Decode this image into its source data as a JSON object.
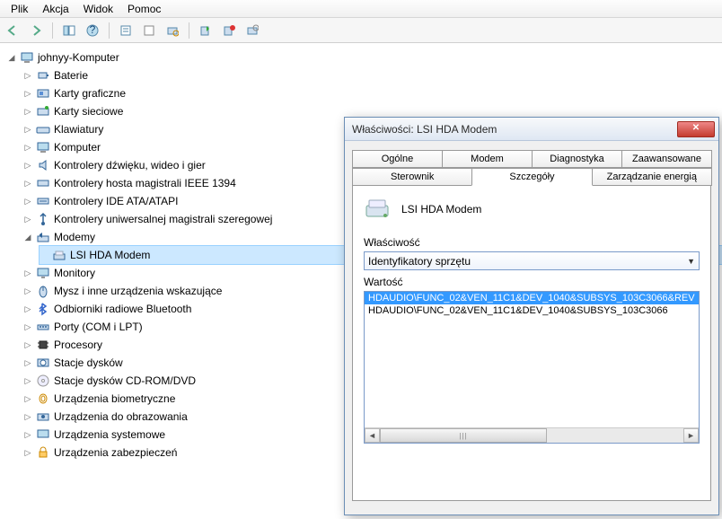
{
  "menu": {
    "file": "Plik",
    "action": "Akcja",
    "view": "Widok",
    "help": "Pomoc"
  },
  "tree": {
    "root": "johnyy-Komputer",
    "items": [
      "Baterie",
      "Karty graficzne",
      "Karty sieciowe",
      "Klawiatury",
      "Komputer",
      "Kontrolery dźwięku, wideo i gier",
      "Kontrolery hosta magistrali IEEE 1394",
      "Kontrolery IDE ATA/ATAPI",
      "Kontrolery uniwersalnej magistrali szeregowej",
      "Modemy"
    ],
    "modem_child": "LSI HDA Modem",
    "items2": [
      "Monitory",
      "Mysz i inne urządzenia wskazujące",
      "Odbiorniki radiowe Bluetooth",
      "Porty (COM i LPT)",
      "Procesory",
      "Stacje dysków",
      "Stacje dysków CD-ROM/DVD",
      "Urządzenia biometryczne",
      "Urządzenia do obrazowania",
      "Urządzenia systemowe",
      "Urządzenia zabezpieczeń"
    ]
  },
  "dialog": {
    "title": "Właściwości: LSI HDA Modem",
    "tabs_row1": [
      "Ogólne",
      "Modem",
      "Diagnostyka",
      "Zaawansowane"
    ],
    "tabs_row2": [
      "Sterownik",
      "Szczegóły",
      "Zarządzanie energią"
    ],
    "device_name": "LSI HDA Modem",
    "property_label": "Właściwość",
    "property_value": "Identyfikatory sprzętu",
    "value_label": "Wartość",
    "values": [
      "HDAUDIO\\FUNC_02&VEN_11C1&DEV_1040&SUBSYS_103C3066&REV",
      "HDAUDIO\\FUNC_02&VEN_11C1&DEV_1040&SUBSYS_103C3066"
    ]
  }
}
